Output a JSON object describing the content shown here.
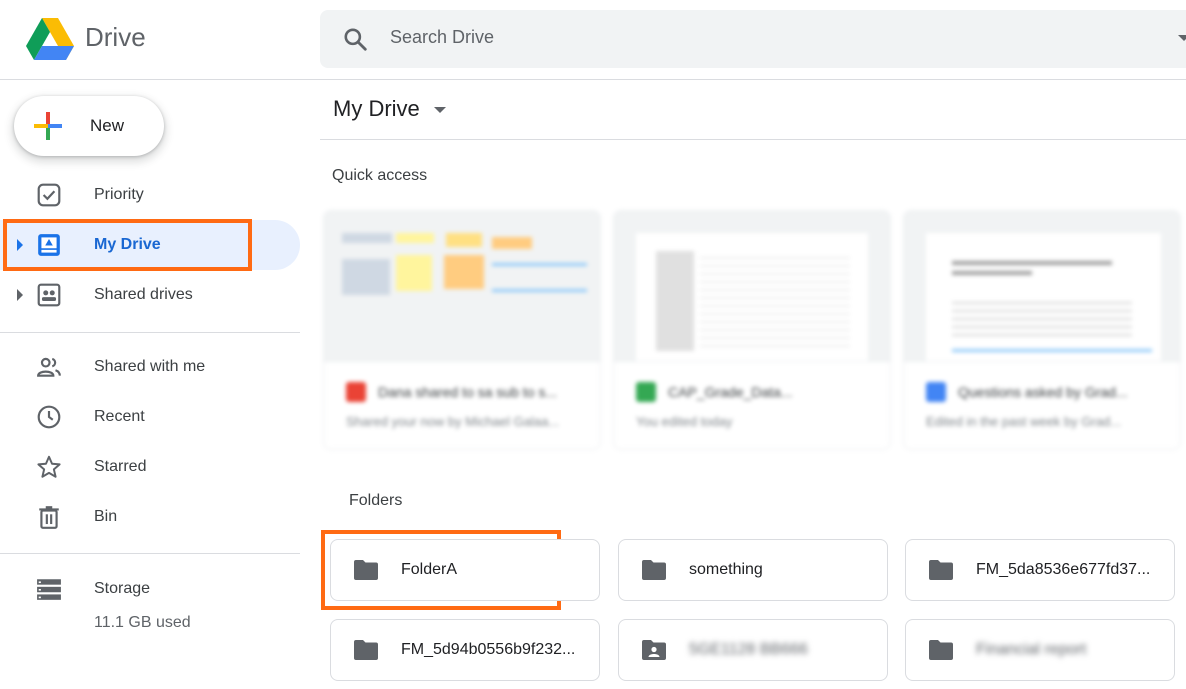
{
  "app": {
    "title": "Drive"
  },
  "search": {
    "placeholder": "Search Drive"
  },
  "sidebar": {
    "new_label": "New",
    "items": [
      {
        "label": "Priority",
        "icon": "priority-check-icon"
      },
      {
        "label": "My Drive",
        "icon": "my-drive-icon",
        "active": true
      },
      {
        "label": "Shared drives",
        "icon": "shared-drives-icon"
      },
      {
        "label": "Shared with me",
        "icon": "people-icon"
      },
      {
        "label": "Recent",
        "icon": "clock-icon"
      },
      {
        "label": "Starred",
        "icon": "star-icon"
      },
      {
        "label": "Bin",
        "icon": "trash-icon"
      },
      {
        "label": "Storage",
        "icon": "storage-icon"
      }
    ],
    "storage_used": "11.1 GB used"
  },
  "main": {
    "breadcrumb": "My Drive",
    "quick_access_title": "Quick access",
    "folders_title": "Folders",
    "quick_access": [
      {
        "name": "Dana shared to sa sub to s...",
        "sub": "Shared your now by Michael Galaa...",
        "badge_color": "#ea4335"
      },
      {
        "name": "CAP_Grade_Data...",
        "sub": "You edited today",
        "badge_color": "#34a853"
      },
      {
        "name": "Questions asked by Grad...",
        "sub": "Edited in the past week by Grad...",
        "badge_color": "#4285f4"
      }
    ],
    "folders": [
      {
        "name": "FolderA",
        "icon": "folder-icon"
      },
      {
        "name": "something",
        "icon": "folder-icon"
      },
      {
        "name": "FM_5da8536e677fd37...",
        "icon": "folder-icon"
      },
      {
        "name": "FM_5d94b0556b9f232...",
        "icon": "folder-icon"
      },
      {
        "name": "5GE1128 BB666",
        "icon": "shared-folder-icon"
      },
      {
        "name": "Financial report",
        "icon": "folder-icon"
      }
    ]
  },
  "colors": {
    "accent": "#1a73e8",
    "active_bg": "#e8f0fe",
    "highlight": "#ff6a13"
  }
}
